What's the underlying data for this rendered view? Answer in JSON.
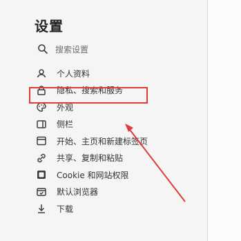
{
  "settings": {
    "title": "设置",
    "search": {
      "placeholder": "搜索设置"
    },
    "items": [
      {
        "label": "个人资料",
        "icon": "profile-icon"
      },
      {
        "label": "隐私、搜索和服务",
        "icon": "lock-icon",
        "selected": true
      },
      {
        "label": "外观",
        "icon": "appearance-icon"
      },
      {
        "label": "侧栏",
        "icon": "sidebar-icon"
      },
      {
        "label": "开始、主页和新建标签页",
        "icon": "home-tab-icon"
      },
      {
        "label": "共享、复制和粘贴",
        "icon": "share-icon"
      },
      {
        "label": "Cookie 和网站权限",
        "icon": "cookie-permissions-icon"
      },
      {
        "label": "默认浏览器",
        "icon": "browser-icon"
      },
      {
        "label": "下载",
        "icon": "download-icon"
      }
    ]
  },
  "colors": {
    "highlight": "#e03a3a",
    "icon": "#3a3a3a"
  }
}
